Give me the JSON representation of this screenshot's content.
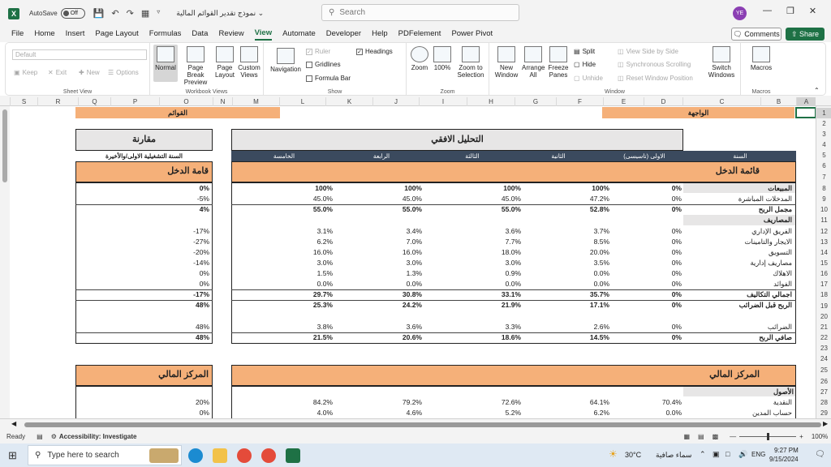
{
  "titlebar": {
    "logo": "X",
    "autosave_label": "AutoSave",
    "autosave_state": "Off",
    "doc_title": "نموذج تقدير القوائم المالية",
    "search_placeholder": "Search",
    "avatar_initials": "YE"
  },
  "menu": {
    "items": [
      "File",
      "Home",
      "Insert",
      "Page Layout",
      "Formulas",
      "Data",
      "Review",
      "View",
      "Automate",
      "Developer",
      "Help",
      "PDFelement",
      "Power Pivot"
    ],
    "active": "View",
    "comments_label": "Comments",
    "share_label": "Share"
  },
  "ribbon": {
    "sheet_view": {
      "dropdown": "Default",
      "keep": "Keep",
      "exit": "Exit",
      "new": "New",
      "options": "Options",
      "label": "Sheet View"
    },
    "workbook_views": {
      "normal": "Normal",
      "page_break": "Page Break Preview",
      "page_layout": "Page Layout",
      "custom": "Custom Views",
      "label": "Workbook Views"
    },
    "show": {
      "navigation": "Navigation",
      "ruler": "Ruler",
      "gridlines": "Gridlines",
      "formula_bar": "Formula Bar",
      "headings": "Headings",
      "label": "Show"
    },
    "zoom": {
      "zoom": "Zoom",
      "hundred": "100%",
      "zoom_selection": "Zoom to Selection",
      "label": "Zoom"
    },
    "window": {
      "new_window": "New Window",
      "arrange_all": "Arrange All",
      "freeze": "Freeze Panes",
      "split": "Split",
      "hide": "Hide",
      "unhide": "Unhide",
      "side_by_side": "View Side by Side",
      "sync_scroll": "Synchronous Scrolling",
      "reset_pos": "Reset Window Position",
      "switch": "Switch Windows",
      "label": "Window"
    },
    "macros": {
      "macros": "Macros",
      "label": "Macros"
    }
  },
  "columns": [
    "S",
    "R",
    "Q",
    "P",
    "O",
    "N",
    "M",
    "L",
    "K",
    "J",
    "I",
    "H",
    "G",
    "F",
    "E",
    "D",
    "C",
    "B",
    "A"
  ],
  "rows": [
    "1",
    "2",
    "3",
    "4",
    "5",
    "6",
    "7",
    "8",
    "9",
    "10",
    "11",
    "12",
    "13",
    "14",
    "15",
    "16",
    "17",
    "18",
    "19",
    "20",
    "21",
    "22",
    "23",
    "24",
    "25",
    "26",
    "27",
    "28",
    "29"
  ],
  "sheet": {
    "header_lists": "القوائم",
    "header_front": "الواجهة",
    "comparison_title": "مقارنة",
    "horizontal_title": "التحليل الافقي",
    "comparison_subtitle": "السنة التشغيلية الاولى/والأخيرة",
    "year_header": "السنة",
    "years": [
      "الاولى (تاسيسى)",
      "الثانية",
      "الثالثة",
      "الرابعة",
      "الخامسة"
    ],
    "income_title": "قائمة الدخل",
    "income_title_left": "قامة الدخل",
    "income_rows": [
      {
        "label": "المبيعات",
        "vals": [
          "0%",
          "100%",
          "100%",
          "100%",
          "100%"
        ],
        "cmp": "0%",
        "bold": true
      },
      {
        "label": "المدخلات المباشرة",
        "vals": [
          "0%",
          "47.2%",
          "45.0%",
          "45.0%",
          "45.0%"
        ],
        "cmp": "-5%",
        "bold": false
      },
      {
        "label": "مجمل الربح",
        "vals": [
          "0%",
          "52.8%",
          "55.0%",
          "55.0%",
          "55.0%"
        ],
        "cmp": "4%",
        "bold": true
      },
      {
        "label": "المصاريف",
        "vals": [
          "",
          "",
          "",
          "",
          ""
        ],
        "cmp": "",
        "bold": true
      },
      {
        "label": "الفريق الإداري",
        "vals": [
          "0%",
          "3.7%",
          "3.6%",
          "3.4%",
          "3.1%"
        ],
        "cmp": "-17%",
        "bold": false
      },
      {
        "label": "الايجار والتامينات",
        "vals": [
          "0%",
          "8.5%",
          "7.7%",
          "7.0%",
          "6.2%"
        ],
        "cmp": "-27%",
        "bold": false
      },
      {
        "label": "التسويق",
        "vals": [
          "0%",
          "20.0%",
          "18.0%",
          "16.0%",
          "16.0%"
        ],
        "cmp": "-20%",
        "bold": false
      },
      {
        "label": "مصاريف إدارية",
        "vals": [
          "0%",
          "3.5%",
          "3.0%",
          "3.0%",
          "3.0%"
        ],
        "cmp": "-14%",
        "bold": false
      },
      {
        "label": "الاهلاك",
        "vals": [
          "0%",
          "0.0%",
          "0.9%",
          "1.3%",
          "1.5%"
        ],
        "cmp": "0%",
        "bold": false
      },
      {
        "label": "الفوائد",
        "vals": [
          "0%",
          "0.0%",
          "0.0%",
          "0.0%",
          "0.0%"
        ],
        "cmp": "0%",
        "bold": false
      },
      {
        "label": "اجمالي التكاليف",
        "vals": [
          "0%",
          "35.7%",
          "33.1%",
          "30.8%",
          "29.7%"
        ],
        "cmp": "-17%",
        "bold": true
      },
      {
        "label": "الربح قبل الضرائب",
        "vals": [
          "0%",
          "17.1%",
          "21.9%",
          "24.2%",
          "25.3%"
        ],
        "cmp": "48%",
        "bold": true
      },
      {
        "label": "",
        "vals": [
          "",
          "",
          "",
          "",
          ""
        ],
        "cmp": "",
        "bold": false
      },
      {
        "label": "الضرائب",
        "vals": [
          "0%",
          "2.6%",
          "3.3%",
          "3.6%",
          "3.8%"
        ],
        "cmp": "48%",
        "bold": false
      },
      {
        "label": "صافي الربح",
        "vals": [
          "0%",
          "14.5%",
          "18.6%",
          "20.6%",
          "21.5%"
        ],
        "cmp": "48%",
        "bold": true
      }
    ],
    "balance_title": "المركز المالي",
    "assets_label": "الأصول",
    "balance_rows": [
      {
        "label": "النقدية",
        "vals": [
          "70.4%",
          "64.1%",
          "72.6%",
          "79.2%",
          "84.2%"
        ],
        "cmp": "20%"
      },
      {
        "label": "حساب المدين",
        "vals": [
          "0.0%",
          "6.2%",
          "5.2%",
          "4.6%",
          "4.0%"
        ],
        "cmp": "0%"
      }
    ]
  },
  "status": {
    "ready": "Ready",
    "accessibility": "Accessibility: Investigate",
    "zoom": "100%"
  },
  "taskbar": {
    "search": "Type here to search",
    "weather_temp": "30°C",
    "weather_desc": "سماء صافية",
    "lang": "ENG",
    "time": "9:27 PM",
    "date": "9/15/2024"
  }
}
